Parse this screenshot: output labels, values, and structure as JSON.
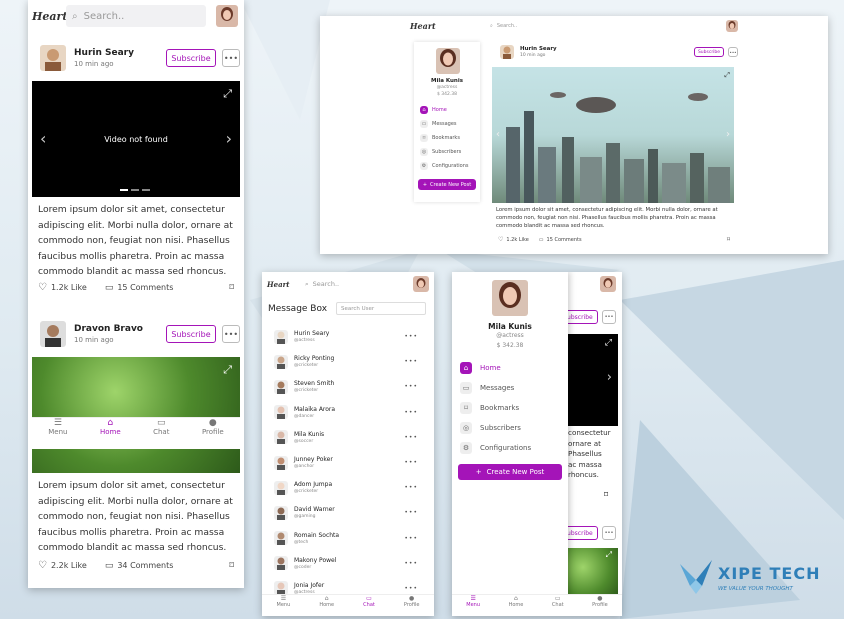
{
  "brand": {
    "logo_text": "Heart"
  },
  "search": {
    "placeholder": "Search..",
    "placeholder_user": "Search User"
  },
  "profile": {
    "name": "Mila Kunis",
    "handle": "@actress",
    "balance": "$ 342.38"
  },
  "menu": {
    "items": [
      {
        "label": "Home",
        "icon": "home-icon"
      },
      {
        "label": "Messages",
        "icon": "chat-icon"
      },
      {
        "label": "Bookmarks",
        "icon": "bookmark-icon"
      },
      {
        "label": "Subscribers",
        "icon": "users-icon"
      },
      {
        "label": "Configurations",
        "icon": "gear-icon"
      }
    ],
    "create_label": "Create New Post"
  },
  "nav": {
    "items": [
      {
        "label": "Menu",
        "icon": "menu-icon"
      },
      {
        "label": "Home",
        "icon": "home-icon"
      },
      {
        "label": "Chat",
        "icon": "chat-icon"
      },
      {
        "label": "Profile",
        "icon": "user-icon"
      }
    ]
  },
  "posts": [
    {
      "author": "Hurin Seary",
      "time": "10 min ago",
      "subscribe_label": "Subscribe",
      "video_text": "Video not found",
      "text": "Lorem ipsum dolor sit amet, consectetur adipiscing elit. Morbi nulla dolor, ornare at commodo non, feugiat non nisi. Phasellus faucibus mollis pharetra. Proin ac massa commodo blandit ac massa sed rhoncus.",
      "likes": "1.2k Like",
      "comments": "15 Comments"
    },
    {
      "author": "Dravon Bravo",
      "time": "10 min ago",
      "subscribe_label": "Subscribe",
      "text": "Lorem ipsum dolor sit amet, consectetur adipiscing elit. Morbi nulla dolor, ornare at commodo non, feugiat non nisi. Phasellus faucibus mollis pharetra. Proin ac massa commodo blandit ac massa sed rhoncus.",
      "likes": "2.2k Like",
      "comments": "34 Comments"
    }
  ],
  "message_box": {
    "title": "Message Box",
    "contacts": [
      {
        "name": "Hurin Seary",
        "handle": "@actress"
      },
      {
        "name": "Ricky Ponting",
        "handle": "@cricketer"
      },
      {
        "name": "Steven Smith",
        "handle": "@cricketer"
      },
      {
        "name": "Malaika Arora",
        "handle": "@dancer"
      },
      {
        "name": "Mila Kunis",
        "handle": "@soccer"
      },
      {
        "name": "Junney Poker",
        "handle": "@anchor"
      },
      {
        "name": "Adom Jumpa",
        "handle": "@cricketer"
      },
      {
        "name": "David Warner",
        "handle": "@gaming"
      },
      {
        "name": "Romain Sochta",
        "handle": "@tech"
      },
      {
        "name": "Makony Powel",
        "handle": "@coder"
      },
      {
        "name": "Jonia Jofer",
        "handle": "@actress"
      }
    ]
  },
  "desktop_post": {
    "author": "Hurin Seary",
    "time": "10 min ago",
    "subscribe_label": "Subscribe",
    "text": "Lorem ipsum dolor sit amet, consectetur adipiscing elit. Morbi nulla dolor, ornare at commodo non, feugiat non nisi. Phasellus faucibus mollis pharetra. Proin ac massa commodo blandit ac massa sed rhoncus.",
    "likes": "1.2k Like",
    "comments": "15 Comments"
  },
  "menu_panel_peek": {
    "subscribe_label": "Subscribe",
    "text_lines": [
      "consectetur",
      "ornare at",
      "Phasellus",
      "ac massa",
      "rhoncus."
    ]
  },
  "watermark": {
    "brand": "XIPE TECH",
    "tagline": "WE VALUE YOUR THOUGHT"
  },
  "colors": {
    "accent": "#a414b8",
    "video_bg": "#000000"
  }
}
